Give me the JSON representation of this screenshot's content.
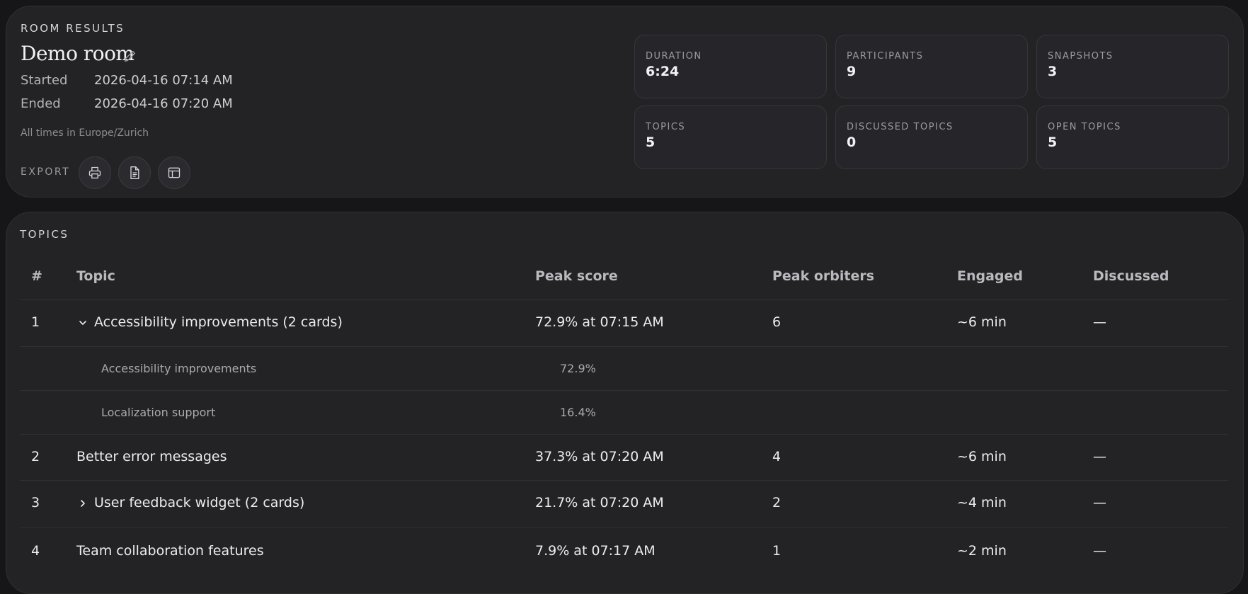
{
  "results": {
    "section_label": "ROOM RESULTS",
    "room_name": "Demo room",
    "started_label": "Started",
    "started_value": "2026-04-16 07:14 AM",
    "ended_label": "Ended",
    "ended_value": "2026-04-16 07:20 AM",
    "timezone_note": "All times in Europe/Zurich",
    "export_label": "EXPORT",
    "export_icons": [
      "printer-icon",
      "document-icon",
      "spreadsheet-icon"
    ]
  },
  "stats": [
    {
      "label": "DURATION",
      "value": "6:24"
    },
    {
      "label": "PARTICIPANTS",
      "value": "9"
    },
    {
      "label": "SNAPSHOTS",
      "value": "3"
    },
    {
      "label": "TOPICS",
      "value": "5"
    },
    {
      "label": "DISCUSSED TOPICS",
      "value": "0"
    },
    {
      "label": "OPEN TOPICS",
      "value": "5"
    }
  ],
  "topics": {
    "section_label": "TOPICS",
    "columns": [
      "#",
      "Topic",
      "Peak score",
      "Peak orbiters",
      "Engaged",
      "Discussed"
    ],
    "rows": [
      {
        "num": "1",
        "topic": "Accessibility improvements (2 cards)",
        "peak_score": "72.9% at 07:15 AM",
        "peak_orbiters": "6",
        "engaged": "~6 min",
        "discussed": "—",
        "expander": "expanded"
      },
      {
        "num": "2",
        "topic": "Better error messages",
        "peak_score": "37.3% at 07:20 AM",
        "peak_orbiters": "4",
        "engaged": "~6 min",
        "discussed": "—",
        "expander": "none"
      },
      {
        "num": "3",
        "topic": "User feedback widget (2 cards)",
        "peak_score": "21.7% at 07:20 AM",
        "peak_orbiters": "2",
        "engaged": "~4 min",
        "discussed": "—",
        "expander": "collapsed"
      },
      {
        "num": "4",
        "topic": "Team collaboration features",
        "peak_score": "7.9% at 07:17 AM",
        "peak_orbiters": "1",
        "engaged": "~2 min",
        "discussed": "—",
        "expander": "none"
      }
    ],
    "subrows": [
      {
        "name": "Accessibility improvements",
        "score": "72.9%"
      },
      {
        "name": "Localization support",
        "score": "16.4%"
      }
    ]
  },
  "colors": {
    "background": "#161618",
    "panel": "#232326",
    "text": "#ececef",
    "muted": "#9a9aa0"
  }
}
